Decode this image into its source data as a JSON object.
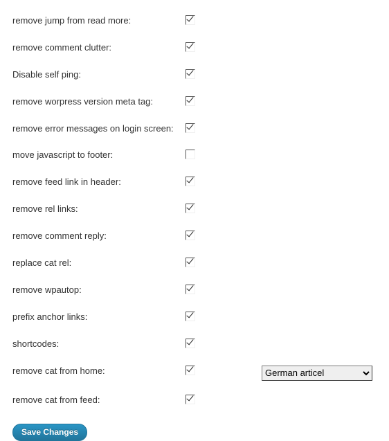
{
  "options": [
    {
      "label": "remove jump from read more:",
      "checked": true
    },
    {
      "label": "remove comment clutter:",
      "checked": true
    },
    {
      "label": "Disable self ping:",
      "checked": true
    },
    {
      "label": "remove worpress version meta tag:",
      "checked": true
    },
    {
      "label": "remove error messages on login screen:",
      "checked": true
    },
    {
      "label": "move javascript to footer:",
      "checked": false
    },
    {
      "label": "remove feed link in header:",
      "checked": true
    },
    {
      "label": "remove rel links:",
      "checked": true
    },
    {
      "label": "remove comment reply:",
      "checked": true
    },
    {
      "label": "replace cat rel:",
      "checked": true
    },
    {
      "label": "remove wpautop:",
      "checked": true
    },
    {
      "label": "prefix anchor links:",
      "checked": true
    },
    {
      "label": "shortcodes:",
      "checked": true
    },
    {
      "label": "remove cat from home:",
      "checked": true
    },
    {
      "label": "remove cat from feed:",
      "checked": true
    }
  ],
  "dropdown_row_index": 13,
  "dropdown": {
    "selected": "German articel"
  },
  "save_button": "Save Changes"
}
